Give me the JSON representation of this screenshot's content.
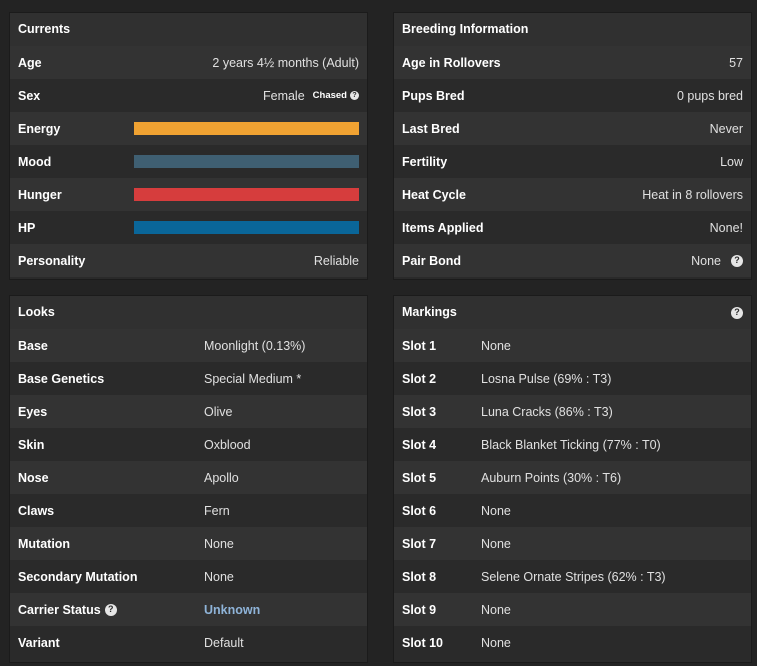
{
  "currents": {
    "title": "Currents",
    "age_label": "Age",
    "age_value": "2 years 4½ months (Adult)",
    "sex_label": "Sex",
    "sex_value": "Female",
    "sex_tag": "Chased",
    "energy_label": "Energy",
    "energy_color": "#f0a232",
    "energy_fraction": 1.0,
    "mood_label": "Mood",
    "mood_color": "#3f5f72",
    "mood_fraction": 1.0,
    "hunger_label": "Hunger",
    "hunger_color": "#d63d3d",
    "hunger_fraction": 1.0,
    "hp_label": "HP",
    "hp_color": "#0a6699",
    "hp_fraction": 1.0,
    "personality_label": "Personality",
    "personality_value": "Reliable"
  },
  "breeding": {
    "title": "Breeding Information",
    "rows": [
      {
        "label": "Age in Rollovers",
        "value": "57"
      },
      {
        "label": "Pups Bred",
        "value": "0 pups bred"
      },
      {
        "label": "Last Bred",
        "value": "Never"
      },
      {
        "label": "Fertility",
        "value": "Low"
      },
      {
        "label": "Heat Cycle",
        "value": "Heat in 8 rollovers"
      },
      {
        "label": "Items Applied",
        "value": "None!"
      },
      {
        "label": "Pair Bond",
        "value": "None"
      }
    ]
  },
  "looks": {
    "title": "Looks",
    "rows": [
      {
        "label": "Base",
        "value": "Moonlight (0.13%)"
      },
      {
        "label": "Base Genetics",
        "value": "Special Medium *"
      },
      {
        "label": "Eyes",
        "value": "Olive"
      },
      {
        "label": "Skin",
        "value": "Oxblood"
      },
      {
        "label": "Nose",
        "value": "Apollo"
      },
      {
        "label": "Claws",
        "value": "Fern"
      },
      {
        "label": "Mutation",
        "value": "None"
      },
      {
        "label": "Secondary Mutation",
        "value": "None"
      },
      {
        "label": "Carrier Status",
        "value": "Unknown"
      },
      {
        "label": "Variant",
        "value": "Default"
      }
    ]
  },
  "markings": {
    "title": "Markings",
    "rows": [
      {
        "label": "Slot 1",
        "value": "None"
      },
      {
        "label": "Slot 2",
        "value": "Losna Pulse (69% : T3)"
      },
      {
        "label": "Slot 3",
        "value": "Luna Cracks (86% : T3)"
      },
      {
        "label": "Slot 4",
        "value": "Black Blanket Ticking (77% : T0)"
      },
      {
        "label": "Slot 5",
        "value": "Auburn Points (30% : T6)"
      },
      {
        "label": "Slot 6",
        "value": "None"
      },
      {
        "label": "Slot 7",
        "value": "None"
      },
      {
        "label": "Slot 8",
        "value": "Selene Ornate Stripes (62% : T3)"
      },
      {
        "label": "Slot 9",
        "value": "None"
      },
      {
        "label": "Slot 10",
        "value": "None"
      }
    ]
  },
  "icons": {
    "help": "question-mark-circle-icon",
    "help_glyph": "?"
  }
}
